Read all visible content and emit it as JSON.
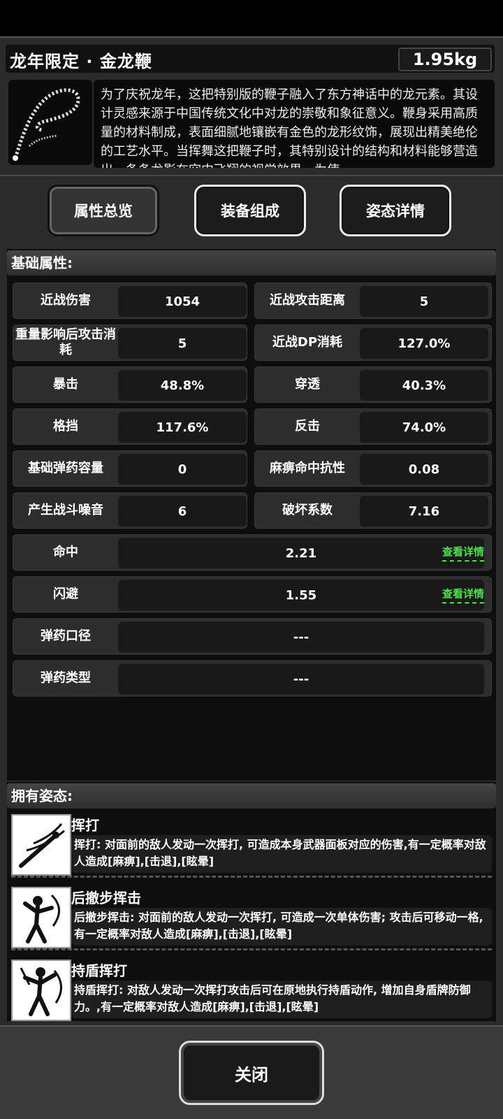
{
  "header": {
    "title": "龙年限定 · 金龙鞭",
    "weight": "1.95kg",
    "description": "为了庆祝龙年，这把特别版的鞭子融入了东方神话中的龙元素。其设计灵感来源于中国传统文化中对龙的崇敬和象征意义。鞭身采用高质量的材料制成，表面细腻地镶嵌有金色的龙形纹饰，展现出精美绝伦的工艺水平。当挥舞这把鞭子时，其特别设计的结构和材料能够营造出一条条龙影在空中飞翔的视觉效果，为使"
  },
  "tabs": [
    {
      "label": "属性总览"
    },
    {
      "label": "装备组成"
    },
    {
      "label": "姿态详情"
    }
  ],
  "basic": {
    "heading": "基础属性:",
    "pairs": [
      {
        "l1": "近战伤害",
        "v1": "1054",
        "l2": "近战攻击距离",
        "v2": "5"
      },
      {
        "l1": "重量影响后攻击消耗",
        "v1": "5",
        "l2": "近战DP消耗",
        "v2": "127.0%"
      },
      {
        "l1": "暴击",
        "v1": "48.8%",
        "l2": "穿透",
        "v2": "40.3%"
      },
      {
        "l1": "格挡",
        "v1": "117.6%",
        "l2": "反击",
        "v2": "74.0%"
      },
      {
        "l1": "基础弹药容量",
        "v1": "0",
        "l2": "麻痹命中抗性",
        "v2": "0.08"
      },
      {
        "l1": "产生战斗噪音",
        "v1": "6",
        "l2": "破坏系数",
        "v2": "7.16"
      }
    ],
    "full": [
      {
        "label": "命中",
        "value": "2.21",
        "link": "查看详情"
      },
      {
        "label": "闪避",
        "value": "1.55",
        "link": "查看详情"
      },
      {
        "label": "弹药口径",
        "value": "---"
      },
      {
        "label": "弹药类型",
        "value": "---"
      }
    ]
  },
  "stances": {
    "heading": "拥有姿态:",
    "items": [
      {
        "name": "挥打",
        "desc": "挥打: 对面前的敌人发动一次挥打, 可造成本身武器面板对应的伤害,有一定概率对敌人造成[麻痹],[击退],[眩晕]"
      },
      {
        "name": "后撤步挥击",
        "desc": "后撤步挥击: 对面前的敌人发动一次挥打, 可造成一次单体伤害; 攻击后可移动一格,有一定概率对敌人造成[麻痹],[击退],[眩晕]"
      },
      {
        "name": "持盾挥打",
        "desc": "持盾挥打: 对敌人发动一次挥打攻击后可在原地执行持盾动作, 增加自身盾牌防御力。,有一定概率对敌人造成[麻痹],[击退],[眩晕]"
      }
    ]
  },
  "footer": {
    "close_label": "关闭"
  }
}
